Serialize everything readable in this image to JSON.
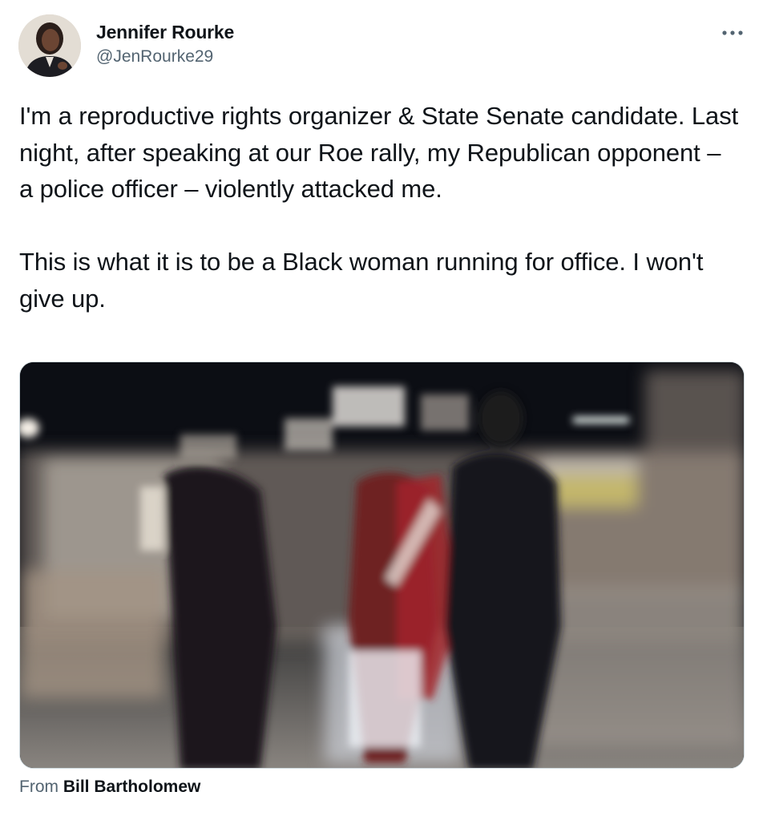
{
  "author": {
    "name": "Jennifer Rourke",
    "handle": "@JenRourke29"
  },
  "tweet": {
    "text": "I'm a reproductive rights organizer & State Senate candidate. Last night, after speaking at our Roe rally, my Republican opponent – a police officer – violently attacked me.\n\nThis is what it is to be a Black woman running for office. I won't give up."
  },
  "media": {
    "type": "video",
    "attribution_prefix": "From",
    "attribution_source": "Bill Bartholomew"
  },
  "icons": {
    "more": "more-icon"
  }
}
